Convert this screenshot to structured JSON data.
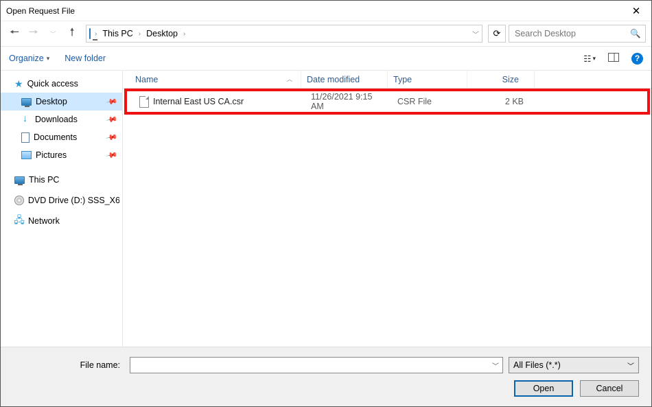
{
  "title": "Open Request File",
  "path": {
    "root": "This PC",
    "folder": "Desktop"
  },
  "search": {
    "placeholder": "Search Desktop"
  },
  "toolbar": {
    "organize": "Organize",
    "newfolder": "New folder"
  },
  "nav": {
    "quick": "Quick access",
    "desktop": "Desktop",
    "downloads": "Downloads",
    "documents": "Documents",
    "pictures": "Pictures",
    "thispc": "This PC",
    "dvd": "DVD Drive (D:) SSS_X6",
    "network": "Network"
  },
  "columns": {
    "name": "Name",
    "date": "Date modified",
    "type": "Type",
    "size": "Size"
  },
  "files": [
    {
      "name": "Internal East US CA.csr",
      "date": "11/26/2021 9:15 AM",
      "type": "CSR File",
      "size": "2 KB"
    }
  ],
  "footer": {
    "filename_label": "File name:",
    "filename_value": "",
    "filter": "All Files (*.*)",
    "open": "Open",
    "cancel": "Cancel"
  }
}
